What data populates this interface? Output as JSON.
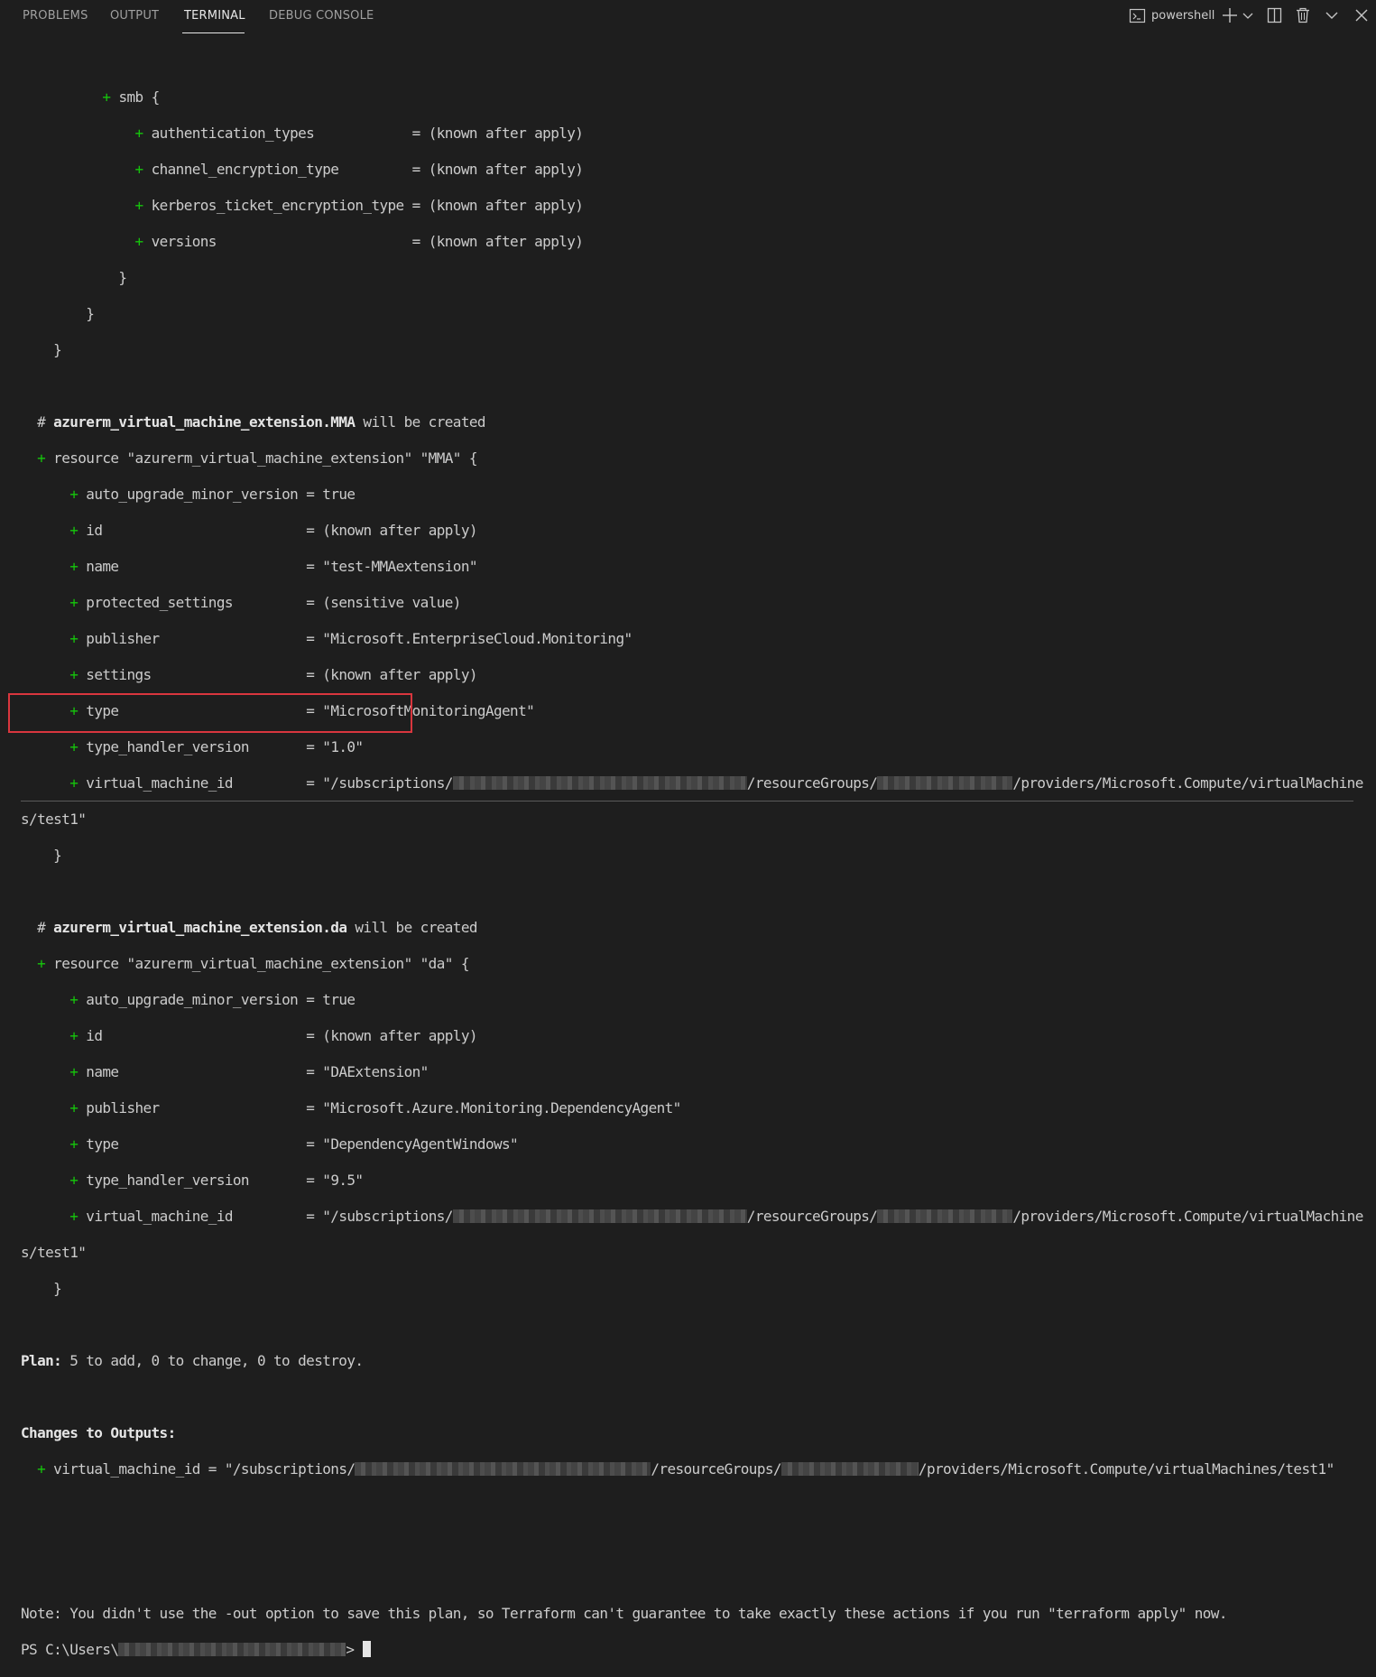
{
  "tabs": {
    "problems": "PROBLEMS",
    "output": "OUTPUT",
    "terminal": "TERMINAL",
    "debug_console": "DEBUG CONSOLE"
  },
  "toolbar": {
    "shell_name": "powershell",
    "icons": [
      "terminal-icon",
      "plus-icon",
      "chevron-down-icon",
      "split-icon",
      "trash-icon",
      "chevron-up-down-icon",
      "close-icon"
    ]
  },
  "terminal": {
    "smb": {
      "open": "smb {",
      "fields": [
        {
          "key": "authentication_types",
          "pad": "           ",
          "value": "(known after apply)"
        },
        {
          "key": "channel_encryption_type",
          "pad": "        ",
          "value": "(known after apply)"
        },
        {
          "key": "kerberos_ticket_encryption_type",
          "pad": "",
          "value": "(known after apply)"
        },
        {
          "key": "versions",
          "pad": "                       ",
          "value": "(known after apply)"
        }
      ]
    },
    "mma": {
      "comment_name": "azurerm_virtual_machine_extension.MMA",
      "comment_suffix": " will be created",
      "resource": "resource \"azurerm_virtual_machine_extension\" \"MMA\" {",
      "fields": [
        {
          "key": "auto_upgrade_minor_version",
          "pad": " ",
          "value": "true"
        },
        {
          "key": "id",
          "pad": "                         ",
          "value": "(known after apply)"
        },
        {
          "key": "name",
          "pad": "                       ",
          "value": "\"test-MMAextension\""
        },
        {
          "key": "protected_settings",
          "pad": "         ",
          "value": "(sensitive value)"
        },
        {
          "key": "publisher",
          "pad": "                  ",
          "value": "\"Microsoft.EnterpriseCloud.Monitoring\""
        },
        {
          "key": "settings",
          "pad": "                   ",
          "value": "(known after apply)"
        },
        {
          "key": "type",
          "pad": "                       ",
          "value": "\"MicrosoftMonitoringAgent\""
        },
        {
          "key": "type_handler_version",
          "pad": "       ",
          "value": "\"1.0\""
        }
      ],
      "vm_key": "virtual_machine_id",
      "vm_pad": "         ",
      "vm_value_start": "\"/subscriptions/",
      "vm_value_mid": "/resourceGroups/",
      "vm_value_end": "/providers/Microsoft.Compute/virtualMachine",
      "vm_wrap": "s/test1\""
    },
    "da": {
      "comment_name": "azurerm_virtual_machine_extension.da",
      "comment_suffix": " will be created",
      "resource": "resource \"azurerm_virtual_machine_extension\" \"da\" {",
      "fields": [
        {
          "key": "auto_upgrade_minor_version",
          "pad": " ",
          "value": "true"
        },
        {
          "key": "id",
          "pad": "                         ",
          "value": "(known after apply)"
        },
        {
          "key": "name",
          "pad": "                       ",
          "value": "\"DAExtension\""
        },
        {
          "key": "publisher",
          "pad": "                  ",
          "value": "\"Microsoft.Azure.Monitoring.DependencyAgent\""
        },
        {
          "key": "type",
          "pad": "                       ",
          "value": "\"DependencyAgentWindows\""
        },
        {
          "key": "type_handler_version",
          "pad": "       ",
          "value": "\"9.5\""
        }
      ],
      "vm_key": "virtual_machine_id",
      "vm_pad": "         ",
      "vm_value_start": "\"/subscriptions/",
      "vm_value_mid": "/resourceGroups/",
      "vm_value_end": "/providers/Microsoft.Compute/virtualMachine",
      "vm_wrap": "s/test1\""
    },
    "plan_label": "Plan:",
    "plan_text": " 5 to add, 0 to change, 0 to destroy.",
    "outputs_label": "Changes to Outputs:",
    "output_key": "virtual_machine_id = \"/subscriptions/",
    "output_mid": "/resourceGroups/",
    "output_end": "/providers/Microsoft.Compute/virtualMachines/test1\"",
    "note": "Note: You didn't use the -out option to save this plan, so Terraform can't guarantee to take exactly these actions if you run \"terraform apply\" now.",
    "prompt_start": "PS C:\\Users\\",
    "prompt_end": ">"
  }
}
